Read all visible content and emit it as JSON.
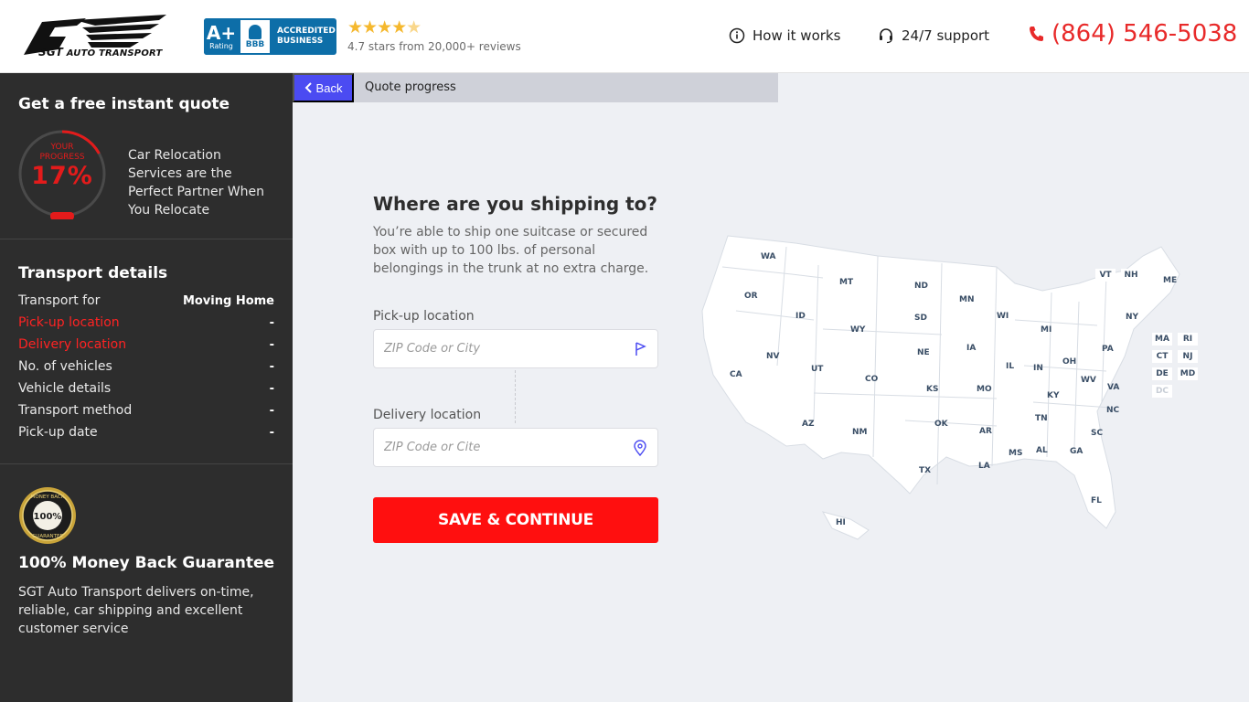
{
  "brand": {
    "logo_main": "SGT",
    "logo_sub": "AUTO TRANSPORT"
  },
  "bbb": {
    "grade": "A+",
    "rating_label": "Rating",
    "logo_label": "BBB",
    "accredited_line1": "ACCREDITED",
    "accredited_line2": "BUSINESS"
  },
  "reviews": {
    "stars": 4.7,
    "stars_glyphs": "★★★★",
    "stars_half": "★",
    "text": "4.7 stars from 20,000+ reviews"
  },
  "nav": {
    "how_it_works": "How it works",
    "support": "24/7 support",
    "phone": "(864) 546-5038"
  },
  "sidebar": {
    "title": "Get a free instant quote",
    "progress_label_1": "YOUR",
    "progress_label_2": "PROGRESS",
    "progress_value": "17%",
    "progress_fraction": 0.17,
    "tagline": "Car Relocation Services are the Perfect Partner When You Relocate",
    "transport_title": "Transport details",
    "rows": [
      {
        "label": "Transport for",
        "value": "Moving Home",
        "active": false
      },
      {
        "label": "Pick-up location",
        "value": "-",
        "active": true
      },
      {
        "label": "Delivery location",
        "value": "-",
        "active": true
      },
      {
        "label": "No. of vehicles",
        "value": "-",
        "active": false
      },
      {
        "label": "Vehicle details",
        "value": "-",
        "active": false
      },
      {
        "label": "Transport method",
        "value": "-",
        "active": false
      },
      {
        "label": "Pick-up date",
        "value": "-",
        "active": false
      }
    ],
    "guarantee_badge_top": "MONEY BACK",
    "guarantee_badge_pct": "100%",
    "guarantee_badge_bottom": "GUARANTEE",
    "guarantee_title": "100% Money Back Guarantee",
    "guarantee_text": "SGT Auto Transport delivers on-time, reliable, car shipping and excellent customer service"
  },
  "progress_bar": {
    "back_label": "Back",
    "title": "Quote progress"
  },
  "form": {
    "title": "Where are you shipping to?",
    "description": "You’re able to ship one suitcase or secured box with up to 100 lbs. of personal belongings in the trunk at no extra charge.",
    "pickup_label": "Pick-up location",
    "pickup_placeholder": "ZIP Code or City",
    "delivery_label": "Delivery location",
    "delivery_placeholder": "ZIP Code or Cite",
    "submit_label": "SAVE & CONTINUE"
  },
  "map": {
    "states": [
      "WA",
      "OR",
      "CA",
      "ID",
      "NV",
      "MT",
      "WY",
      "UT",
      "AZ",
      "CO",
      "NM",
      "ND",
      "SD",
      "NE",
      "KS",
      "OK",
      "TX",
      "MN",
      "IA",
      "MO",
      "AR",
      "LA",
      "WI",
      "IL",
      "MI",
      "IN",
      "OH",
      "KY",
      "TN",
      "MS",
      "AL",
      "GA",
      "FL",
      "SC",
      "NC",
      "VA",
      "WV",
      "PA",
      "NY",
      "ME",
      "HI"
    ],
    "small_states": [
      "VT",
      "NH",
      "MA",
      "RI",
      "CT",
      "NJ",
      "DE",
      "MD",
      "DC"
    ]
  },
  "colors": {
    "accent_red": "#ff0f0f",
    "back_blue": "#4b4bf2",
    "sidebar_bg": "#2d2d2d",
    "bbb_blue": "#0d6ea8",
    "star_gold": "#f5b82e"
  }
}
